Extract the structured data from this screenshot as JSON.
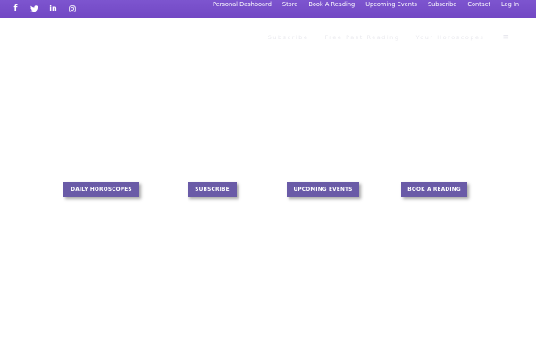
{
  "social": [
    {
      "icon": "facebook-icon",
      "glyph": "f"
    },
    {
      "icon": "twitter-icon",
      "glyph": ""
    },
    {
      "icon": "linkedin-icon",
      "glyph": "in"
    },
    {
      "icon": "instagram-icon",
      "glyph": ""
    }
  ],
  "top_nav": {
    "items": [
      "Personal Dashboard",
      "Store",
      "Book A Reading",
      "Upcoming Events",
      "Subscribe",
      "Contact",
      "Log In"
    ]
  },
  "main_nav": {
    "items": [
      "Subscribe",
      "Free Past Reading",
      "Your Horoscopes"
    ],
    "menu_icon": "≡"
  },
  "cta": {
    "daily_horoscopes": "DAILY HOROSCOPES",
    "subscribe": "SUBSCRIBE",
    "upcoming_events": "UPCOMING EVENTS",
    "book_a_reading": "BOOK A READING"
  },
  "colors": {
    "topbar": "#7248c4",
    "button": "#6a5ba7",
    "background": "#ffffff"
  }
}
